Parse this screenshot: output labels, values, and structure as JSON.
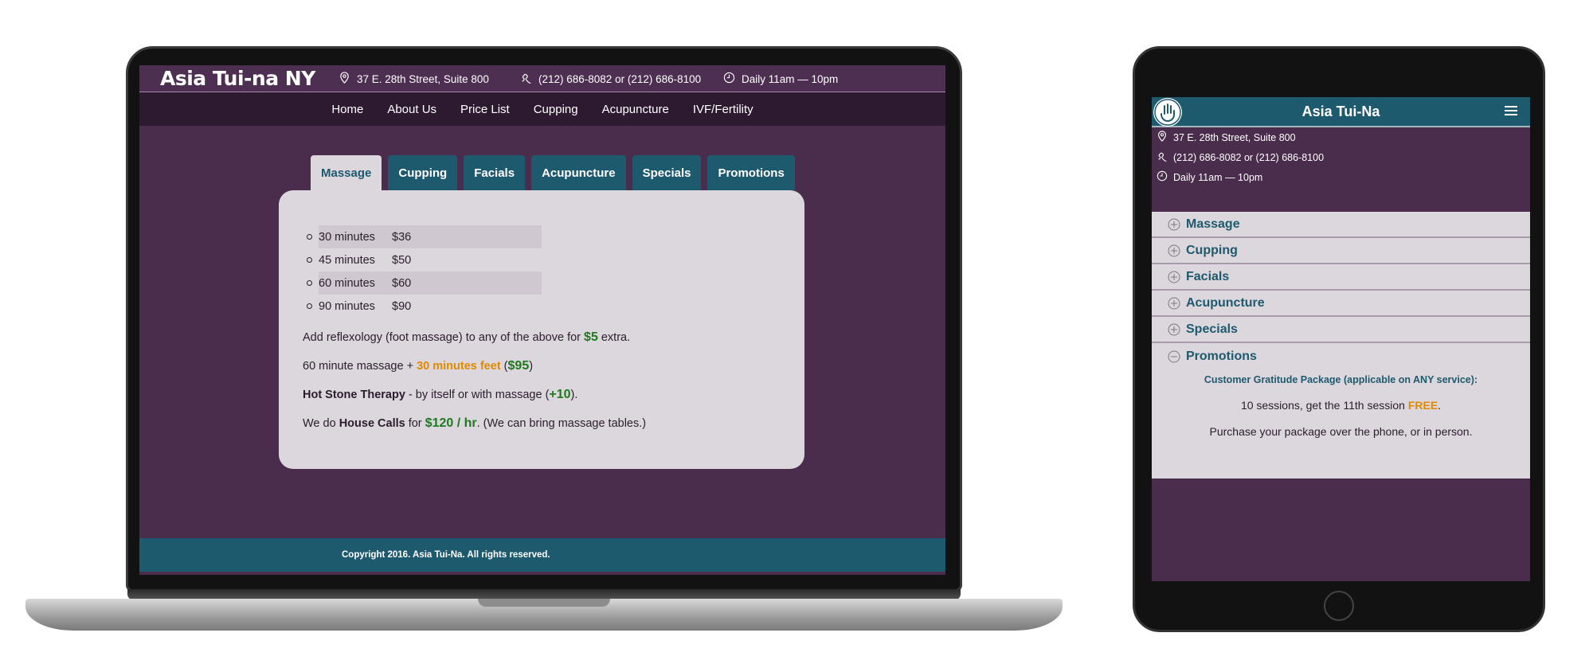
{
  "laptop": {
    "brand": "Asia Tui-na NY",
    "address": "37 E. 28th Street, Suite 800",
    "phone": "(212) 686-8082 or (212) 686-8100",
    "hours": "Daily 11am — 10pm",
    "nav": [
      "Home",
      "About Us",
      "Price List",
      "Cupping",
      "Acupuncture",
      "IVF/Fertility"
    ],
    "tabs": [
      "Massage",
      "Cupping",
      "Facials",
      "Acupuncture",
      "Specials",
      "Promotions"
    ],
    "active_tab": "Massage",
    "prices": [
      {
        "duration": "30 minutes",
        "price": "$36"
      },
      {
        "duration": "45 minutes",
        "price": "$50"
      },
      {
        "duration": "60 minutes",
        "price": "$60"
      },
      {
        "duration": "90 minutes",
        "price": "$90"
      }
    ],
    "reflexology": {
      "pre": "Add reflexology (foot massage) to any of the above for ",
      "amount": "$5",
      "post": " extra."
    },
    "combo": {
      "pre": "60 minute massage + ",
      "feet": "30 minutes feet",
      "open": " (",
      "amount": "$95",
      "close": ")"
    },
    "hot_stone": {
      "name": "Hot Stone Therapy",
      "mid": " - by itself or with massage (",
      "amount": "+10",
      "close": ")."
    },
    "house_calls": {
      "pre": "We do ",
      "name": "House Calls",
      "mid": " for ",
      "amount": "$120 / hr",
      "post": ". (We can bring massage tables.)"
    },
    "footer": "Copyright 2016. Asia Tui-Na. All rights reserved."
  },
  "tablet": {
    "title": "Asia Tui-Na",
    "address": "37 E. 28th Street, Suite 800",
    "phone": "(212) 686-8082 or (212) 686-8100",
    "hours": "Daily 11am — 10pm",
    "accordion": [
      "Massage",
      "Cupping",
      "Facials",
      "Acupuncture",
      "Specials",
      "Promotions"
    ],
    "promo_header": "Customer Gratitude Package (applicable on ANY service):",
    "promo_line1_pre": "10 sessions, get the 11th session ",
    "promo_free": "FREE",
    "promo_line1_post": ".",
    "promo_line2": "Purchase your package over the phone, or in person."
  },
  "colors": {
    "purple": "#4a2c4d",
    "teal": "#1e5a6e",
    "panel": "#dcd6dd",
    "green": "#1e7a1e",
    "orange": "#e08a00"
  }
}
